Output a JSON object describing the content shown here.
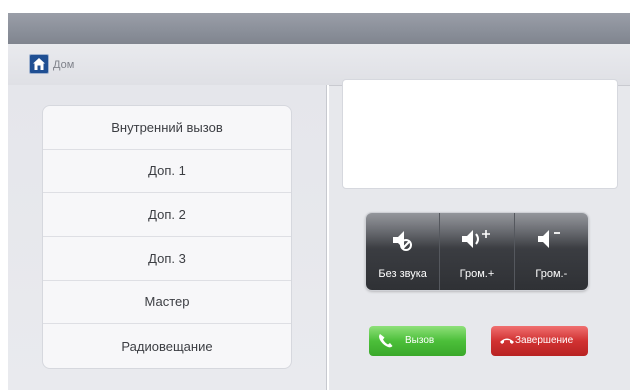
{
  "header": {
    "breadcrumb": "Дом",
    "icon": "home-icon"
  },
  "menu": {
    "items": [
      {
        "label": "Внутренний вызов"
      },
      {
        "label": "Доп. 1"
      },
      {
        "label": "Доп. 2"
      },
      {
        "label": "Доп. 3"
      },
      {
        "label": "Мастер"
      },
      {
        "label": "Радиовещание"
      }
    ]
  },
  "audio": {
    "mute": {
      "label": "Без звука",
      "icon": "speaker-mute-icon"
    },
    "vol_up": {
      "label": "Гром.+",
      "icon": "volume-up-icon"
    },
    "vol_down": {
      "label": "Гром.-",
      "icon": "volume-down-icon"
    }
  },
  "actions": {
    "call": {
      "label": "Вызов",
      "icon": "phone-icon",
      "color": "#4cbf3a"
    },
    "end": {
      "label": "Завершение",
      "icon": "hangup-icon",
      "color": "#d13232"
    }
  }
}
